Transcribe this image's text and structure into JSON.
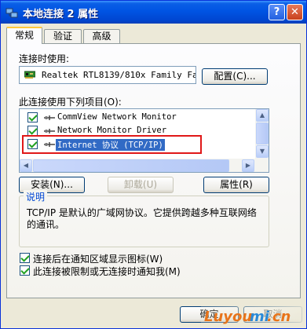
{
  "window": {
    "title": "本地连接 2 属性",
    "help_glyph": "?",
    "close_glyph": "✕",
    "title_icon": "network-connection-icon"
  },
  "tabs": [
    {
      "label": "常规",
      "active": true
    },
    {
      "label": "验证",
      "active": false
    },
    {
      "label": "高级",
      "active": false
    }
  ],
  "connect_using": {
    "label": "连接时使用:",
    "adapter_name": "Realtek RTL8139/810x Family Fa",
    "adapter_icon": "network-card-icon",
    "configure_button": "配置(C)..."
  },
  "components": {
    "label": "此连接使用下列项目(O):",
    "items": [
      {
        "label": "CommView Network Monitor",
        "checked": true,
        "icon": "service-icon"
      },
      {
        "label": "Network Monitor Driver",
        "checked": true,
        "icon": "service-icon"
      },
      {
        "label": "Internet 协议 (TCP/IP)",
        "checked": true,
        "icon": "protocol-icon",
        "selected": true
      }
    ],
    "scroll_up": "▲",
    "scroll_down": "▼",
    "scroll_left": "◀",
    "scroll_right": "▶"
  },
  "actions": {
    "install": "安装(N)...",
    "uninstall": "卸载(U)",
    "properties": "属性(R)"
  },
  "description": {
    "title": "说明",
    "text": "TCP/IP 是默认的广域网协议。它提供跨越多种互联网络的通讯。"
  },
  "options": [
    {
      "label": "连接后在通知区域显示图标(W)",
      "checked": true
    },
    {
      "label": "此连接被限制或无连接时通知我(M)",
      "checked": true
    }
  ],
  "footer": {
    "ok": "确定",
    "cancel": "取消"
  },
  "watermark": {
    "text_1": "Luyou",
    "text_2": "mi",
    "text_3": ".cn"
  },
  "colors": {
    "titlebar": "#0054e3",
    "selection": "#316ac5",
    "highlight_box": "#e01818",
    "group_title": "#0046d5"
  }
}
